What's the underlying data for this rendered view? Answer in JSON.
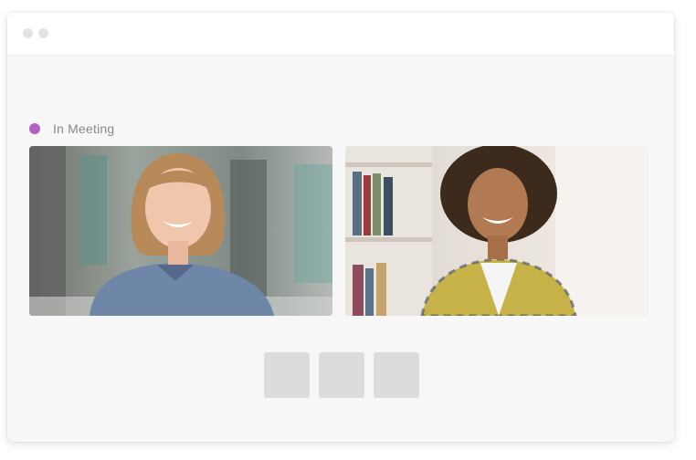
{
  "window": {
    "title": ""
  },
  "meeting": {
    "status_label": "In Meeting",
    "status_color": "#b160c4"
  },
  "participants": [
    {
      "video": "participant-1-video"
    },
    {
      "video": "participant-2-video"
    }
  ],
  "controls": [
    {
      "name": "control-button-1"
    },
    {
      "name": "control-button-2"
    },
    {
      "name": "control-button-3"
    }
  ]
}
